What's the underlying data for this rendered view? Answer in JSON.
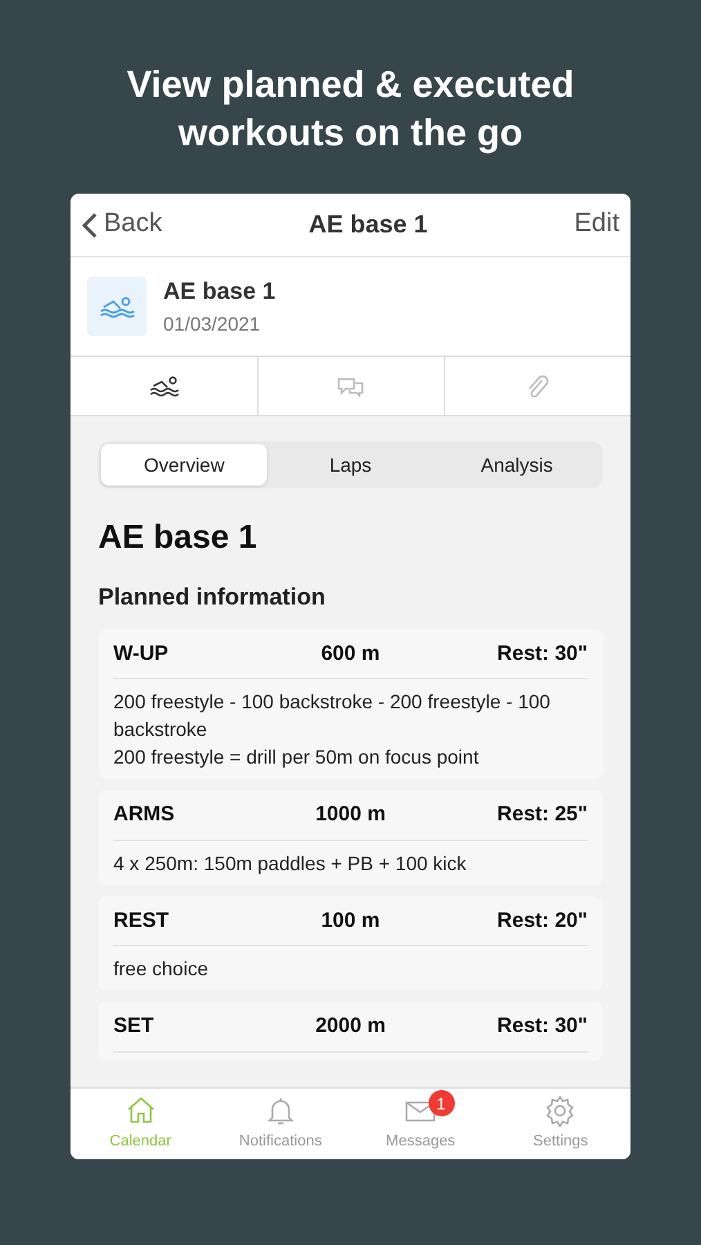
{
  "headline": "View planned & executed workouts on the go",
  "nav": {
    "back": "Back",
    "title": "AE base 1",
    "action": "Edit"
  },
  "workout": {
    "name": "AE base 1",
    "date": "01/03/2021"
  },
  "icon_tabs": [
    {
      "kind": "swim",
      "selected": true
    },
    {
      "kind": "comments",
      "selected": false
    },
    {
      "kind": "attachments",
      "selected": false
    }
  ],
  "segments": [
    {
      "label": "Overview",
      "selected": true
    },
    {
      "label": "Laps",
      "selected": false
    },
    {
      "label": "Analysis",
      "selected": false
    }
  ],
  "heading": "AE base 1",
  "section_title": "Planned information",
  "intervals": [
    {
      "name": "W-UP",
      "distance": "600 m",
      "rest": "Rest: 30\"",
      "lines": [
        "200 freestyle - 100 backstroke - 200 freestyle - 100 backstroke",
        "200 freestyle = drill per 50m on focus point"
      ]
    },
    {
      "name": "ARMS",
      "distance": "1000 m",
      "rest": "Rest: 25\"",
      "lines": [
        "4 x 250m: 150m paddles + PB + 100 kick"
      ]
    },
    {
      "name": "REST",
      "distance": "100 m",
      "rest": "Rest: 20\"",
      "lines": [
        "free choice"
      ]
    },
    {
      "name": "SET",
      "distance": "2000 m",
      "rest": "Rest: 30\""
    }
  ],
  "tab_bar": [
    {
      "kind": "home",
      "label": "Calendar",
      "selected": true
    },
    {
      "kind": "bell",
      "label": "Notifications",
      "selected": false
    },
    {
      "kind": "mail",
      "label": "Messages",
      "selected": false,
      "badge": "1"
    },
    {
      "kind": "gear",
      "label": "Settings",
      "selected": false
    }
  ]
}
